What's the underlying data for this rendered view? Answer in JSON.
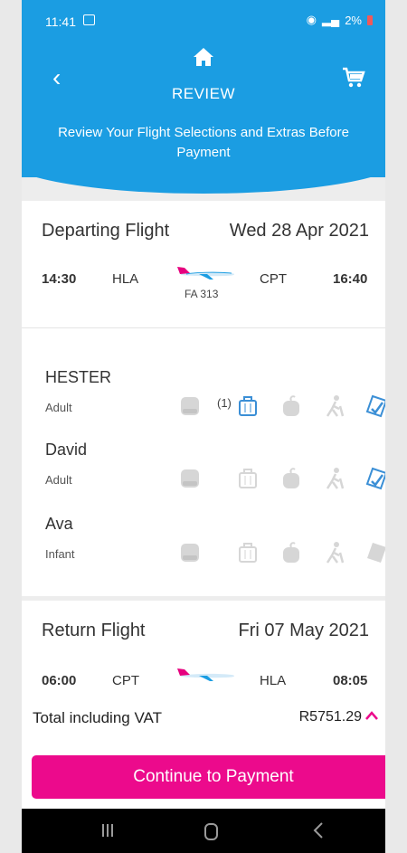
{
  "status": {
    "time": "11:41",
    "network": "VoLTE1",
    "battery": "2%"
  },
  "header": {
    "title": "REVIEW",
    "subtitle": "Review Your Flight Selections and Extras Before Payment"
  },
  "departing": {
    "label": "Departing Flight",
    "date": "Wed 28 Apr 2021",
    "dep_time": "14:30",
    "dep_code": "HLA",
    "flight_no": "FA 313",
    "arr_code": "CPT",
    "arr_time": "16:40"
  },
  "passengers": [
    {
      "name": "HESTER",
      "type": "Adult",
      "bag_count": "(1)",
      "seat": false,
      "bag": true,
      "sport": false,
      "assist": false,
      "insurance": true
    },
    {
      "name": "David",
      "type": "Adult",
      "bag_count": "",
      "seat": false,
      "bag": false,
      "sport": false,
      "assist": false,
      "insurance": true
    },
    {
      "name": "Ava",
      "type": "Infant",
      "bag_count": "",
      "seat": false,
      "bag": false,
      "sport": false,
      "assist": false,
      "insurance": false
    }
  ],
  "return": {
    "label": "Return Flight",
    "date": "Fri 07 May 2021",
    "dep_time": "06:00",
    "dep_code": "CPT",
    "arr_code": "HLA",
    "arr_time": "08:05"
  },
  "footer": {
    "total_label": "Total including VAT",
    "total_value": "R5751.29",
    "pay_button": "Continue to Payment"
  },
  "colors": {
    "brand_blue": "#1b9de2",
    "accent_pink": "#ec0a8c",
    "icon_active": "#3b8fd6",
    "icon_inactive": "#d6d6d6"
  },
  "icons": [
    "home-icon",
    "back-icon",
    "cart-icon",
    "seat-icon",
    "bag-icon",
    "sports-icon",
    "assistance-icon",
    "insurance-icon"
  ]
}
